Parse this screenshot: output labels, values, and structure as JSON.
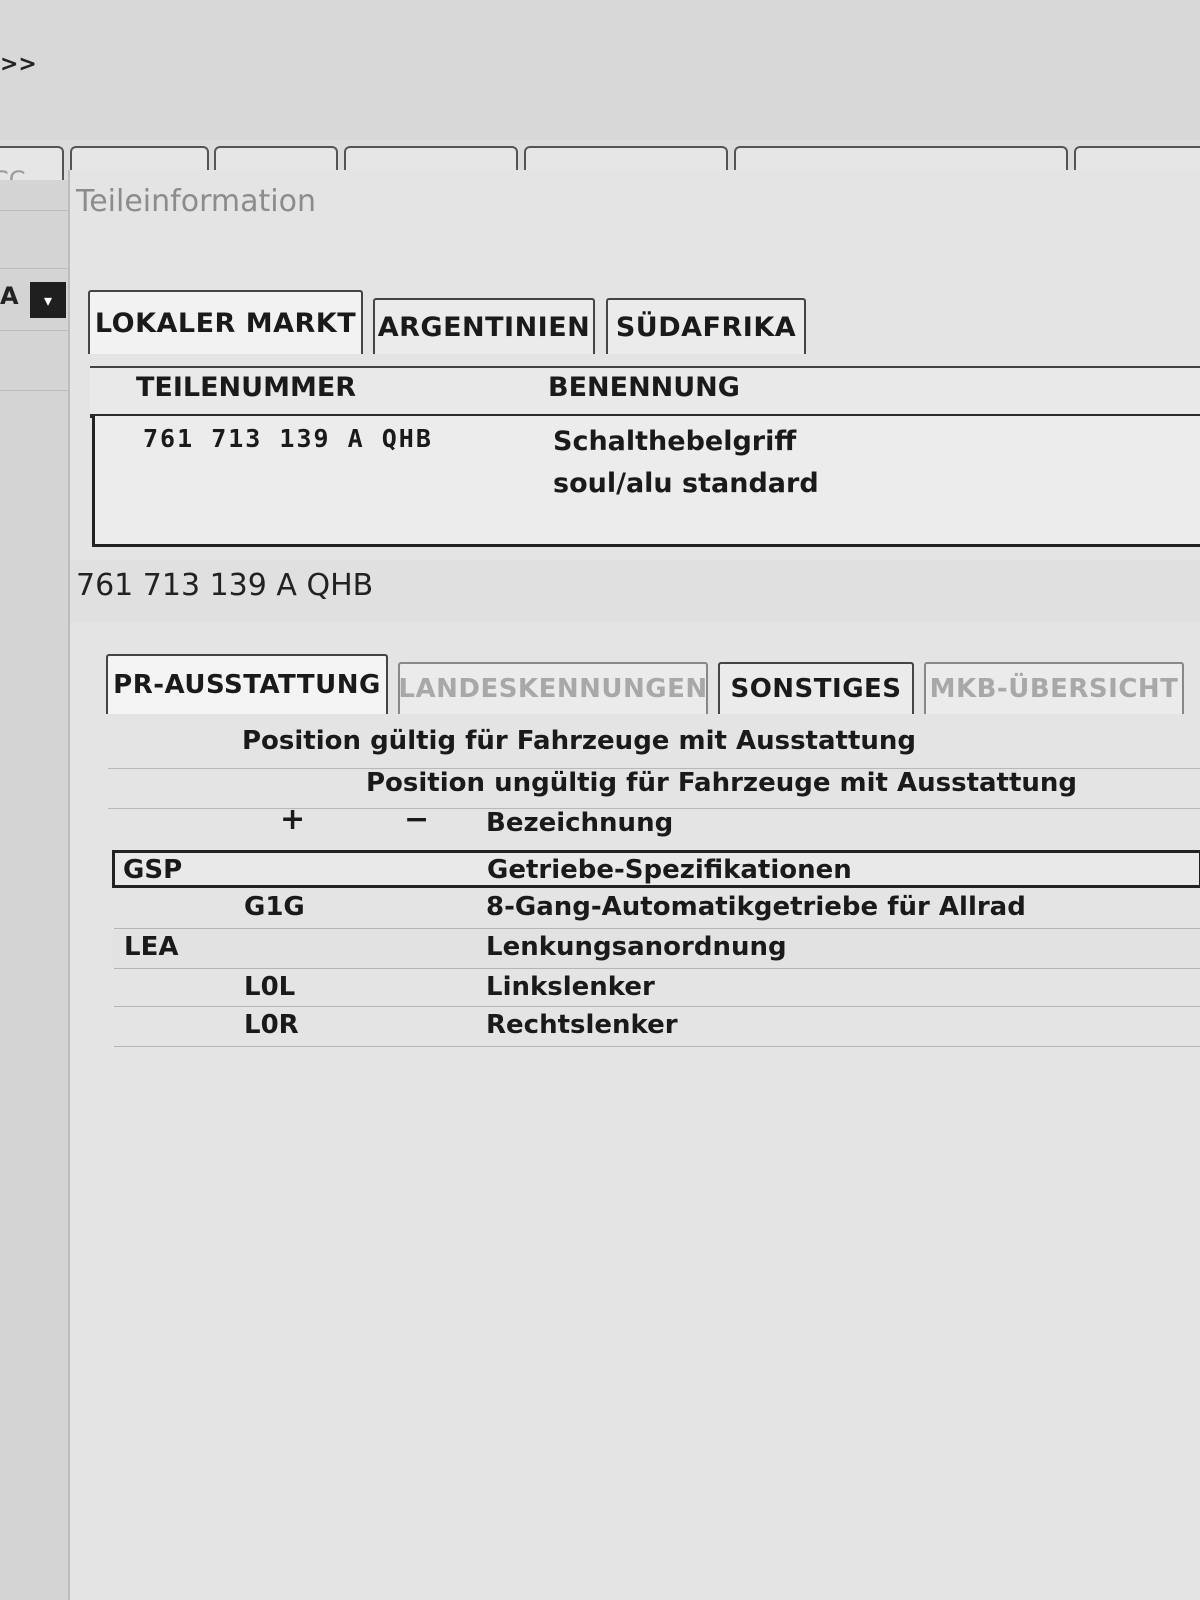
{
  "nav": {
    "arrows": ">>"
  },
  "background_tabs": {
    "first_label": "CC"
  },
  "left": {
    "letter": "A"
  },
  "window": {
    "title": "Teileinformation"
  },
  "market_tabs": [
    {
      "label": "LOKALER MARKT",
      "active": true
    },
    {
      "label": "ARGENTINIEN",
      "active": false
    },
    {
      "label": "SÜDAFRIKA",
      "active": false
    }
  ],
  "parts_table": {
    "headers": {
      "number": "TEILENUMMER",
      "name": "BENENNUNG"
    },
    "row": {
      "number": "761 713 139 A   QHB",
      "name_line1": "Schalthebelgriff",
      "name_line2": "soul/alu standard"
    }
  },
  "selected_part": "761 713 139 A  QHB",
  "detail_tabs": [
    {
      "label": "PR-AUSSTATTUNG",
      "state": "active"
    },
    {
      "label": "LANDESKENNUNGEN",
      "state": "disabled"
    },
    {
      "label": "SONSTIGES",
      "state": "normal"
    },
    {
      "label": "MKB-ÜBERSICHT",
      "state": "disabled"
    }
  ],
  "legend": {
    "valid": "Position gültig für Fahrzeuge mit Ausstattung",
    "invalid": "Position ungültig für Fahrzeuge mit Ausstattung",
    "plus": "+",
    "minus": "−",
    "designation": "Bezeichnung"
  },
  "equipment_rows": [
    {
      "group": "GSP",
      "plus": "",
      "description": "Getriebe-Spezifikationen"
    },
    {
      "group": "",
      "plus": "G1G",
      "description": "8-Gang-Automatikgetriebe für Allrad"
    },
    {
      "group": "LEA",
      "plus": "",
      "description": "Lenkungsanordnung"
    },
    {
      "group": "",
      "plus": "L0L",
      "description": "Linkslenker"
    },
    {
      "group": "",
      "plus": "L0R",
      "description": "Rechtslenker"
    }
  ]
}
